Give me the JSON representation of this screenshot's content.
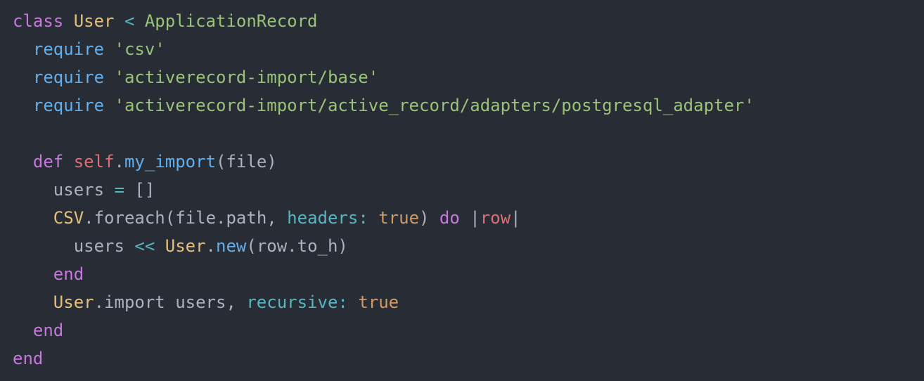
{
  "t": {
    "class": "class",
    "user": "User",
    "lt": " < ",
    "appRecord": "ApplicationRecord",
    "require": "require",
    "sp": " ",
    "strCsv": "'csv'",
    "strImportBase": "'activerecord-import/base'",
    "strImportPg": "'activerecord-import/active_record/adapters/postgresql_adapter'",
    "def": "def",
    "selfDot": "self",
    "dot": ".",
    "myImport": "my_import",
    "lparen": "(",
    "file": "file",
    "rparen": ")",
    "users": "users",
    "eq": " = ",
    "emptyArr": "[]",
    "csvConst": "CSV",
    "foreach": "foreach",
    "path": "path",
    "comma": ", ",
    "headersSym": "headers:",
    "trueLit": "true",
    "doKw": "do",
    "pipe": "|",
    "row": "row",
    "push": " << ",
    "newM": "new",
    "toH": "to_h",
    "endKw": "end",
    "importM": "import",
    "recursiveSym": "recursive:"
  }
}
